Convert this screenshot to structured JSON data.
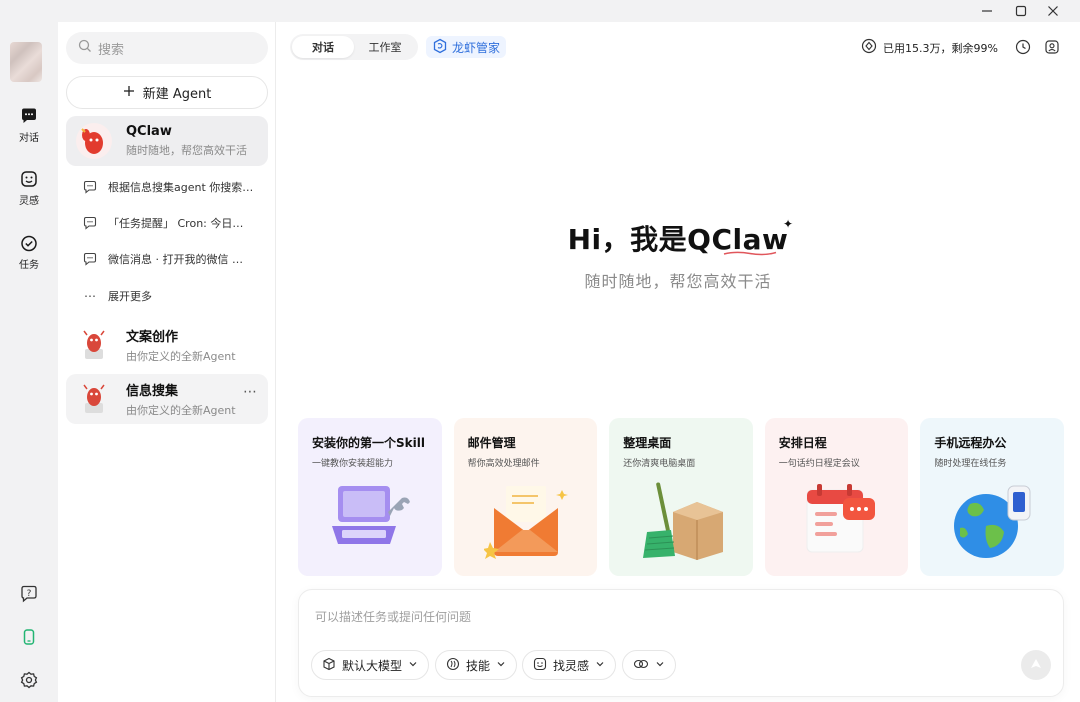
{
  "window": {
    "minimize_icon": "minimize-icon",
    "maximize_icon": "maximize-icon",
    "close_icon": "close-icon"
  },
  "rail": {
    "items": [
      {
        "label": "对话",
        "icon": "chat-icon"
      },
      {
        "label": "灵感",
        "icon": "inspiration-icon"
      },
      {
        "label": "任务",
        "icon": "task-icon"
      }
    ],
    "bottom_icons": [
      "help-icon",
      "phone-icon",
      "settings-icon"
    ]
  },
  "sidebar": {
    "search_placeholder": "搜索",
    "new_agent_label": "新建 Agent",
    "agents": [
      {
        "name": "QClaw",
        "subtitle": "随时随地，帮您高效干活"
      },
      {
        "name": "文案创作",
        "subtitle": "由你定义的全新Agent"
      },
      {
        "name": "信息搜集",
        "subtitle": "由你定义的全新Agent"
      }
    ],
    "conversations": [
      "根据信息搜集agent 你搜索…",
      "「任务提醒」 Cron: 今日最…",
      "微信消息 · 打开我的微信 …"
    ],
    "expand_more": "展开更多",
    "more_icon": "⋯"
  },
  "header": {
    "tabs": [
      "对话",
      "工作室"
    ],
    "lobster_label": "龙虾管家",
    "usage_text": "已用15.3万，剩余99%"
  },
  "hero": {
    "title": "Hi，我是QClaw",
    "subtitle": "随时随地，帮您高效干活"
  },
  "cards": [
    {
      "title": "安装你的第一个Skill",
      "subtitle": "一键教你安装超能力",
      "bg": "#f3f0fd",
      "icon": "laptop-wrench-icon"
    },
    {
      "title": "邮件管理",
      "subtitle": "帮你高效处理邮件",
      "bg": "#fdf4ee",
      "icon": "envelope-icon"
    },
    {
      "title": "整理桌面",
      "subtitle": "还你清爽电脑桌面",
      "bg": "#eff8f1",
      "icon": "broom-box-icon"
    },
    {
      "title": "安排日程",
      "subtitle": "一句话约日程定会议",
      "bg": "#fdf1f1",
      "icon": "calendar-icon"
    },
    {
      "title": "手机远程办公",
      "subtitle": "随时处理在线任务",
      "bg": "#eef7fb",
      "icon": "globe-phone-icon"
    }
  ],
  "composer": {
    "placeholder": "可以描述任务或提问任何问题",
    "model_label": "默认大模型",
    "skill_label": "技能",
    "inspiration_label": "找灵感"
  },
  "colors": {
    "accent": "#2f6fdc",
    "lobster_red": "#e23b2e"
  }
}
